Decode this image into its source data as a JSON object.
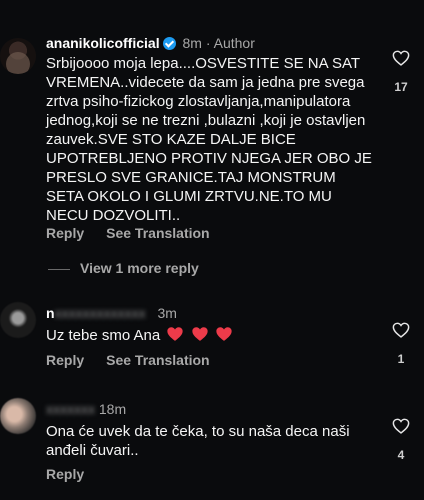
{
  "comments": [
    {
      "username": "ananikolicofficial",
      "time": "8m",
      "role": "Author",
      "text": "Srbijoooo moja lepa....OSVESTITE SE NA SAT VREMENA..videcete da sam ja jedna pre svega zrtva psiho-fizickog zlostavljanja,manipulatora jednog,koji se ne trezni ,bulazni ,koji je ostavljen zauvek.SVE STO KAZE DALJE BICE UPOTREBLJENO PROTIV NJEGA JER OBO JE PRESLO SVE GRANICE.TAJ MONSTRUM SETA OKOLO I GLUMI ZRTVU.NE.TO MU NECU DOZVOLITI..",
      "reply_label": "Reply",
      "translate_label": "See Translation",
      "likes": "17"
    },
    {
      "username": "n",
      "time": "3m",
      "text": "Uz tebe smo Ana",
      "reply_label": "Reply",
      "translate_label": "See Translation",
      "likes": "1"
    },
    {
      "username": "",
      "time": "18m",
      "text": "Ona će uvek da te čeka, to su naša deca naši anđeli čuvari..",
      "reply_label": "Reply",
      "likes": "4"
    }
  ],
  "view_more_label": "View 1 more reply",
  "colors": {
    "background": "#0a0b0d",
    "verified": "#1d9bf0",
    "heart": "#ed4956"
  }
}
